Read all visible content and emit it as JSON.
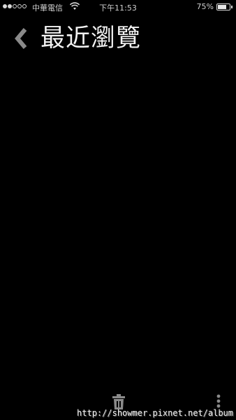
{
  "status_bar": {
    "signal_total": 5,
    "signal_filled": 2,
    "carrier": "中華電信",
    "wifi_icon": "wifi-icon",
    "time": "下午11:53",
    "battery_percent_text": "75%",
    "battery_level": 0.75,
    "battery_icon": "battery-icon"
  },
  "header": {
    "back_icon": "chevron-left-icon",
    "title": "最近瀏覽"
  },
  "toolbar": {
    "trash_icon": "trash-icon",
    "more_icon": "more-vertical-icon"
  },
  "watermark": "http://showmer.pixnet.net/album",
  "colors": {
    "background": "#000000",
    "text": "#f2f2f2",
    "icon": "#8a8a8a"
  }
}
